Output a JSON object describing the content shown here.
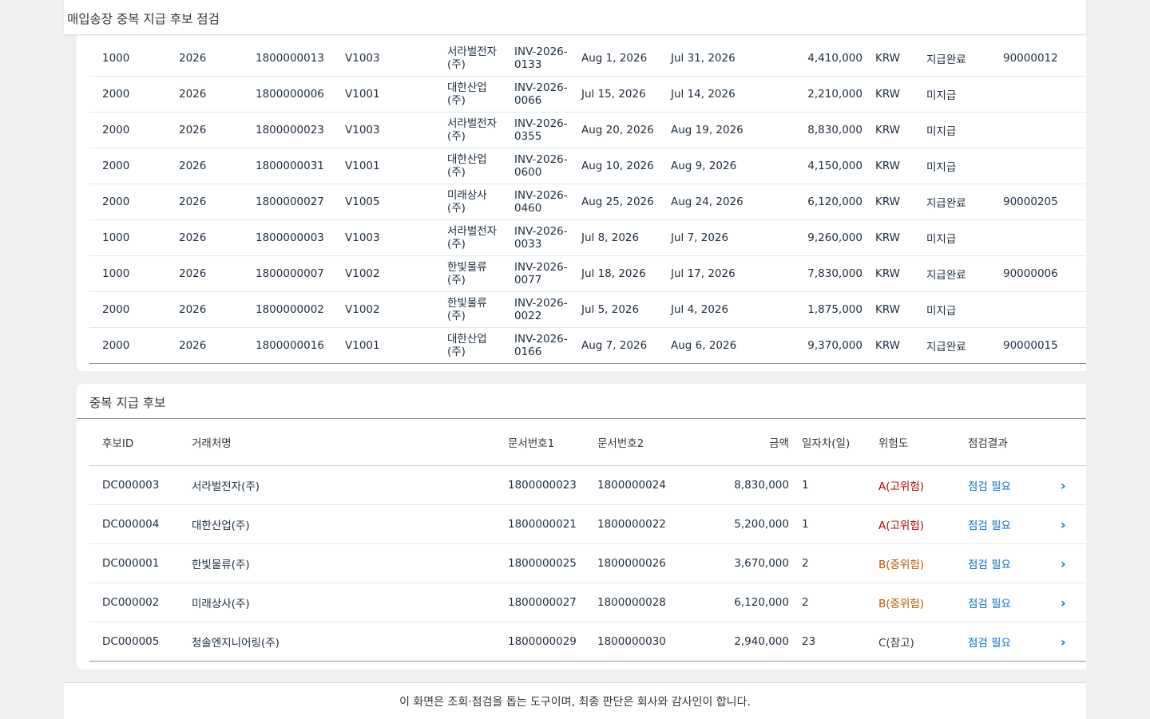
{
  "app": {
    "title": "매입송장 중복 지급 후보 점검"
  },
  "invoices": [
    {
      "company": "1000",
      "year": "2026",
      "doc": "1800000013",
      "vendor": "V1003",
      "vendor_name": "서라벌전자(주)",
      "ref": "INV-2026-0133",
      "doc_date": "Aug 1, 2026",
      "post_date": "Jul 31, 2026",
      "amount": "4,410,000",
      "currency": "KRW",
      "status": "지급완료",
      "payment": "90000012"
    },
    {
      "company": "2000",
      "year": "2026",
      "doc": "1800000006",
      "vendor": "V1001",
      "vendor_name": "대한산업(주)",
      "ref": "INV-2026-0066",
      "doc_date": "Jul 15, 2026",
      "post_date": "Jul 14, 2026",
      "amount": "2,210,000",
      "currency": "KRW",
      "status": "미지급",
      "payment": ""
    },
    {
      "company": "2000",
      "year": "2026",
      "doc": "1800000023",
      "vendor": "V1003",
      "vendor_name": "서라벌전자(주)",
      "ref": "INV-2026-0355",
      "doc_date": "Aug 20, 2026",
      "post_date": "Aug 19, 2026",
      "amount": "8,830,000",
      "currency": "KRW",
      "status": "미지급",
      "payment": ""
    },
    {
      "company": "2000",
      "year": "2026",
      "doc": "1800000031",
      "vendor": "V1001",
      "vendor_name": "대한산업(주)",
      "ref": "INV-2026-0600",
      "doc_date": "Aug 10, 2026",
      "post_date": "Aug 9, 2026",
      "amount": "4,150,000",
      "currency": "KRW",
      "status": "미지급",
      "payment": ""
    },
    {
      "company": "2000",
      "year": "2026",
      "doc": "1800000027",
      "vendor": "V1005",
      "vendor_name": "미래상사(주)",
      "ref": "INV-2026-0460",
      "doc_date": "Aug 25, 2026",
      "post_date": "Aug 24, 2026",
      "amount": "6,120,000",
      "currency": "KRW",
      "status": "지급완료",
      "payment": "90000205"
    },
    {
      "company": "1000",
      "year": "2026",
      "doc": "1800000003",
      "vendor": "V1003",
      "vendor_name": "서라벌전자(주)",
      "ref": "INV-2026-0033",
      "doc_date": "Jul 8, 2026",
      "post_date": "Jul 7, 2026",
      "amount": "9,260,000",
      "currency": "KRW",
      "status": "미지급",
      "payment": ""
    },
    {
      "company": "1000",
      "year": "2026",
      "doc": "1800000007",
      "vendor": "V1002",
      "vendor_name": "한빛물류(주)",
      "ref": "INV-2026-0077",
      "doc_date": "Jul 18, 2026",
      "post_date": "Jul 17, 2026",
      "amount": "7,830,000",
      "currency": "KRW",
      "status": "지급완료",
      "payment": "90000006"
    },
    {
      "company": "2000",
      "year": "2026",
      "doc": "1800000002",
      "vendor": "V1002",
      "vendor_name": "한빛물류(주)",
      "ref": "INV-2026-0022",
      "doc_date": "Jul 5, 2026",
      "post_date": "Jul 4, 2026",
      "amount": "1,875,000",
      "currency": "KRW",
      "status": "미지급",
      "payment": ""
    },
    {
      "company": "2000",
      "year": "2026",
      "doc": "1800000016",
      "vendor": "V1001",
      "vendor_name": "대한산업(주)",
      "ref": "INV-2026-0166",
      "doc_date": "Aug 7, 2026",
      "post_date": "Aug 6, 2026",
      "amount": "9,370,000",
      "currency": "KRW",
      "status": "지급완료",
      "payment": "90000015"
    }
  ],
  "candidates": {
    "title": "중복 지급 후보",
    "headers": {
      "id": "후보ID",
      "vendor": "거래처명",
      "doc1": "문서번호1",
      "doc2": "문서번호2",
      "amount": "금액",
      "day_diff": "일자차(일)",
      "risk": "위험도",
      "result": "점검결과"
    },
    "rows": [
      {
        "id": "DC000003",
        "vendor": "서라벌전자(주)",
        "doc1": "1800000023",
        "doc2": "1800000024",
        "amount": "8,830,000",
        "day_diff": "1",
        "risk": "A(고위험)",
        "risk_level": "a",
        "result": "점검 필요"
      },
      {
        "id": "DC000004",
        "vendor": "대한산업(주)",
        "doc1": "1800000021",
        "doc2": "1800000022",
        "amount": "5,200,000",
        "day_diff": "1",
        "risk": "A(고위험)",
        "risk_level": "a",
        "result": "점검 필요"
      },
      {
        "id": "DC000001",
        "vendor": "한빛물류(주)",
        "doc1": "1800000025",
        "doc2": "1800000026",
        "amount": "3,670,000",
        "day_diff": "2",
        "risk": "B(중위험)",
        "risk_level": "b",
        "result": "점검 필요"
      },
      {
        "id": "DC000002",
        "vendor": "미래상사(주)",
        "doc1": "1800000027",
        "doc2": "1800000028",
        "amount": "6,120,000",
        "day_diff": "2",
        "risk": "B(중위험)",
        "risk_level": "b",
        "result": "점검 필요"
      },
      {
        "id": "DC000005",
        "vendor": "청솔엔지니어링(주)",
        "doc1": "1800000029",
        "doc2": "1800000030",
        "amount": "2,940,000",
        "day_diff": "23",
        "risk": "C(참고)",
        "risk_level": "c",
        "result": "점검 필요"
      }
    ]
  },
  "footer": {
    "text": "이 화면은 조회·점검을 돕는 도구이며, 최종 판단은 회사와 감사인이 합니다."
  },
  "icons": {
    "row_nav": "chevron-right-icon"
  },
  "colors": {
    "risk_high": "#aa0808",
    "risk_medium": "#c35500",
    "link": "#0a6ed1"
  }
}
